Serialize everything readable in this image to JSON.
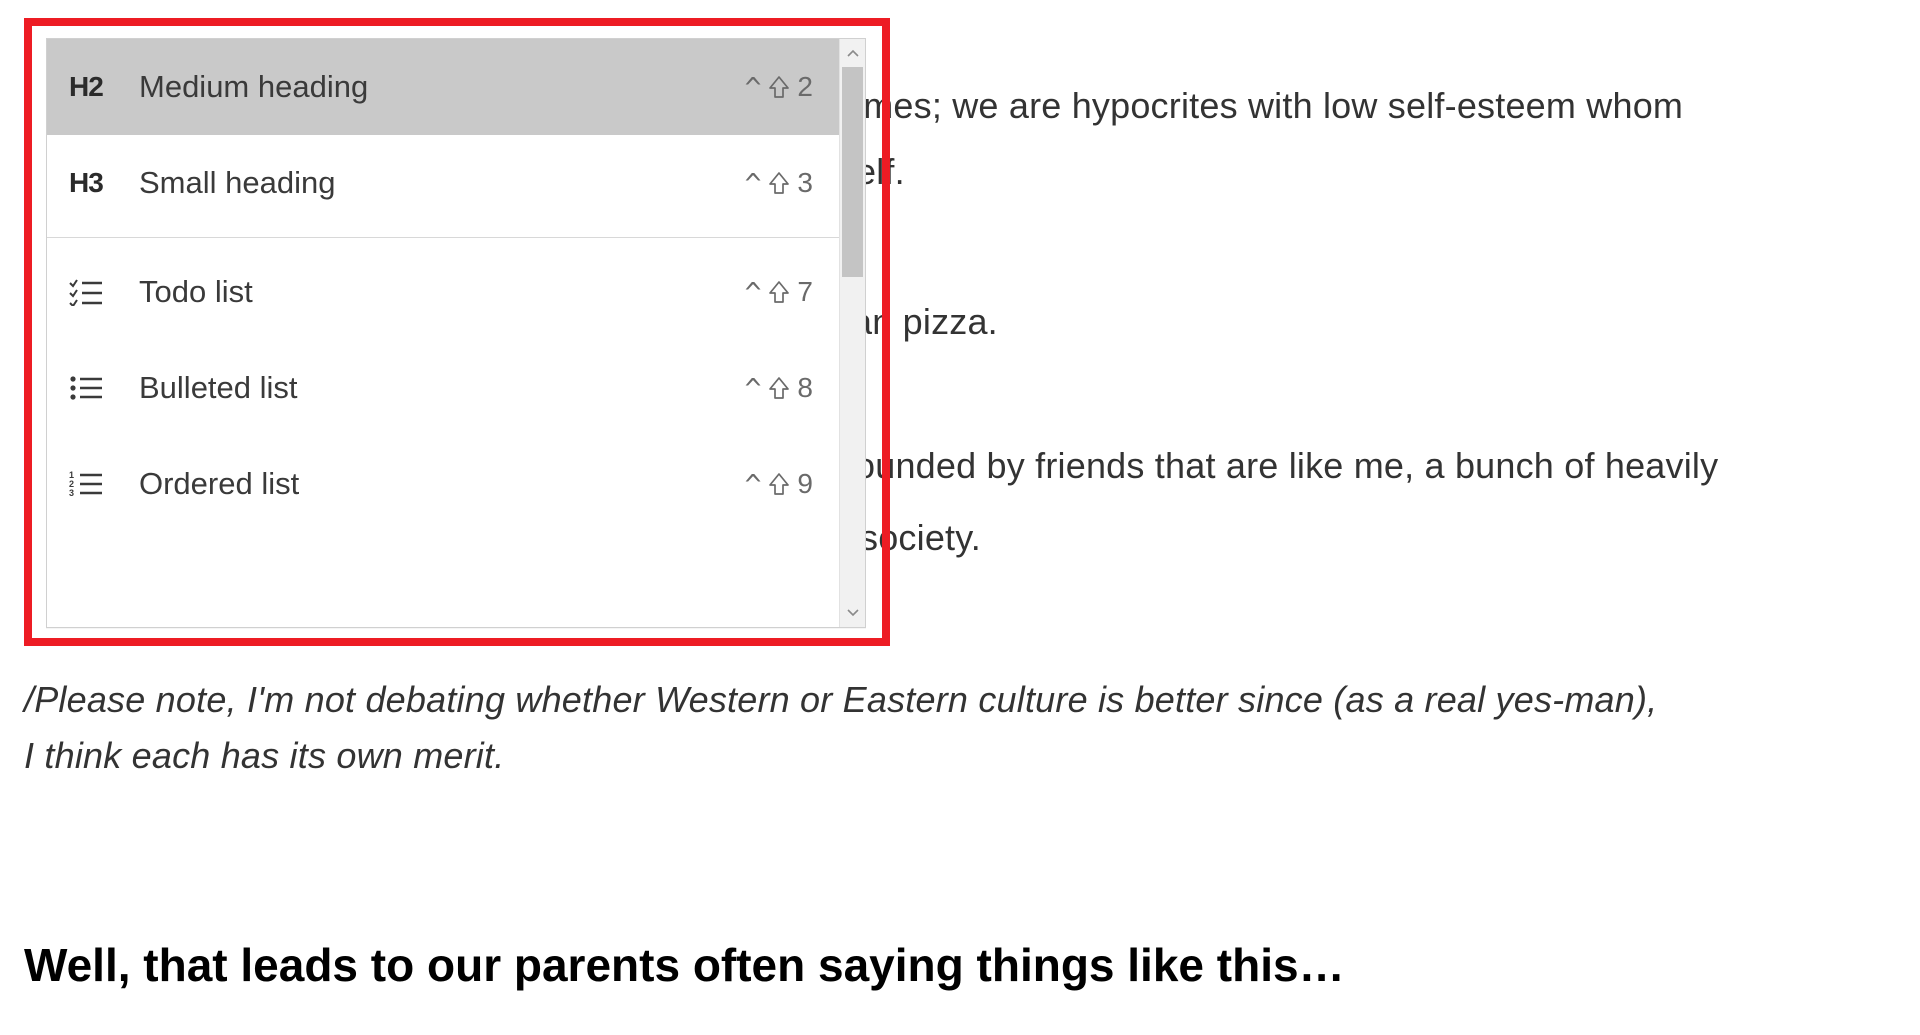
{
  "document": {
    "p1_frag1": "emes; we are hypocrites with low self-esteem whom",
    "p1_frag2": "elf.",
    "p2_frag": "an pizza.",
    "p3_frag1": "ounded by friends that are like me, a bunch of heavily",
    "p3_frag2": " society.",
    "note": "/Please note, I'm not debating whether Western or Eastern culture is better since (as a real yes-man), I think each has its own merit.",
    "heading": "Well, that leads to our parents often saying things like this…"
  },
  "menu": {
    "sections": [
      {
        "items": [
          {
            "icon_text": "H2",
            "label": "Medium heading",
            "shortcut_num": "2",
            "selected": true
          },
          {
            "icon_text": "H3",
            "label": "Small heading",
            "shortcut_num": "3",
            "selected": false
          }
        ]
      },
      {
        "items": [
          {
            "icon_kind": "todo",
            "label": "Todo list",
            "shortcut_num": "7",
            "selected": false
          },
          {
            "icon_kind": "bullet",
            "label": "Bulleted list",
            "shortcut_num": "8",
            "selected": false
          },
          {
            "icon_kind": "ordered",
            "label": "Ordered list",
            "shortcut_num": "9",
            "selected": false
          }
        ]
      }
    ],
    "shortcut_prefix_caret": "^"
  }
}
